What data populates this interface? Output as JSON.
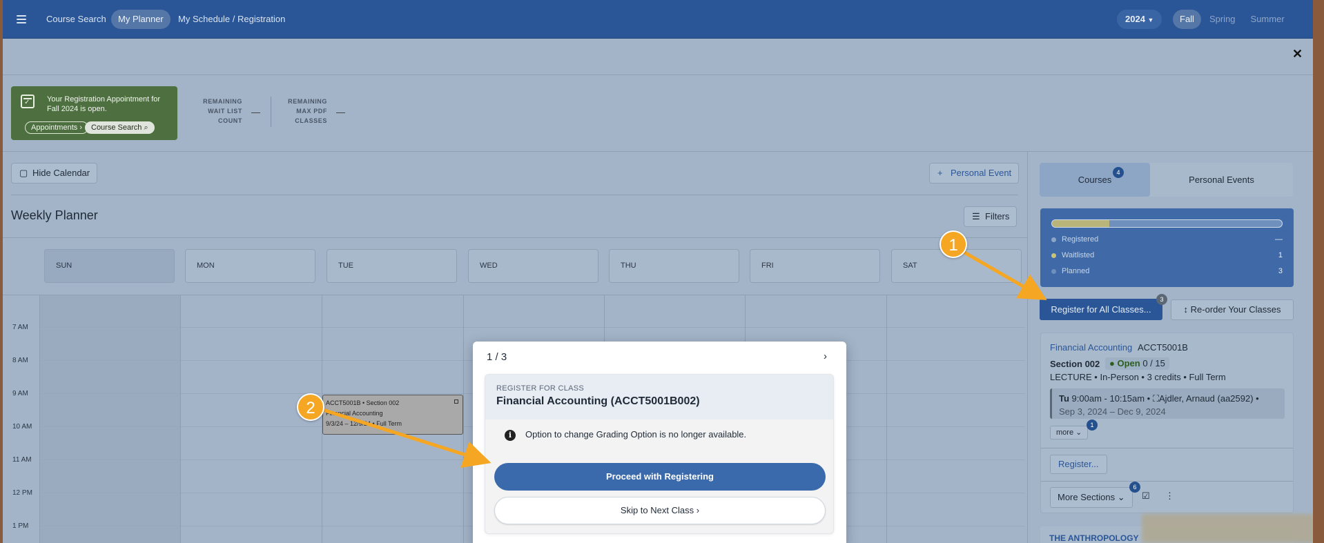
{
  "nav": {
    "items": [
      "Course Search",
      "My Planner",
      "My Schedule / Registration"
    ],
    "year": "2024",
    "terms": [
      "Fall",
      "Spring",
      "Summer"
    ]
  },
  "appointment": {
    "text": "Your Registration Appointment for Fall 2024 is open.",
    "appointments_label": "Appointments",
    "course_search_label": "Course Search"
  },
  "remaining": {
    "waitlist_label_1": "REMAINING",
    "waitlist_label_2": "WAIT LIST",
    "waitlist_label_3": "COUNT",
    "waitlist_value": "—",
    "pdf_label_1": "REMAINING",
    "pdf_label_2": "MAX PDF",
    "pdf_label_3": "CLASSES",
    "pdf_value": "—"
  },
  "toolbar": {
    "hide_calendar": "Hide Calendar",
    "personal_event": "Personal Event",
    "filters": "Filters"
  },
  "planner": {
    "title": "Weekly Planner",
    "days": [
      "SUN",
      "MON",
      "TUE",
      "WED",
      "THU",
      "FRI",
      "SAT"
    ],
    "times": [
      "7 AM",
      "8 AM",
      "9 AM",
      "10 AM",
      "11 AM",
      "12 PM",
      "1 PM"
    ],
    "event": {
      "line1": "ACCT5001B • Section 002",
      "line2": "Financial Accounting",
      "line3": "9/3/24 – 12/9/24 • Full Term"
    }
  },
  "right_panel": {
    "tab_courses": "Courses",
    "tab_courses_badge": "4",
    "tab_personal": "Personal Events",
    "progress_fraction": 0.25,
    "stats": [
      {
        "label": "Registered",
        "value": "—",
        "color": "#8ea6c6"
      },
      {
        "label": "Waitlisted",
        "value": "1",
        "color": "#c9c27a"
      },
      {
        "label": "Planned",
        "value": "3",
        "color": "#6f90bd"
      }
    ],
    "register_all": "Register for All Classes...",
    "register_all_badge": "3",
    "reorder": "Re-order Your Classes"
  },
  "course": {
    "name": "Financial Accounting",
    "code": "ACCT5001B",
    "section": "Section 002",
    "status": "Open",
    "seats": "0 / 15",
    "details": "LECTURE • In-Person • 3 credits • Full Term",
    "meeting_day": "Tu",
    "meeting_time": "9:00am - 10:15am •",
    "instructor": "Ajdler, Arnaud (aa2592) •",
    "dates": "Sep 3, 2024 – Dec 9, 2024",
    "more": "more",
    "more_badge": "1",
    "register": "Register...",
    "more_sections": "More Sections",
    "more_sections_badge": "6"
  },
  "next_course_partial": "THE ANTHROPOLOGY",
  "modal": {
    "counter": "1 / 3",
    "eyebrow": "REGISTER FOR CLASS",
    "title": "Financial Accounting (ACCT5001B002)",
    "info": "Option to change Grading Option is no longer available.",
    "proceed": "Proceed with Registering",
    "skip": "Skip to Next Class"
  },
  "annotations": {
    "step1": "1",
    "step2": "2",
    "color": "#f5a623"
  }
}
